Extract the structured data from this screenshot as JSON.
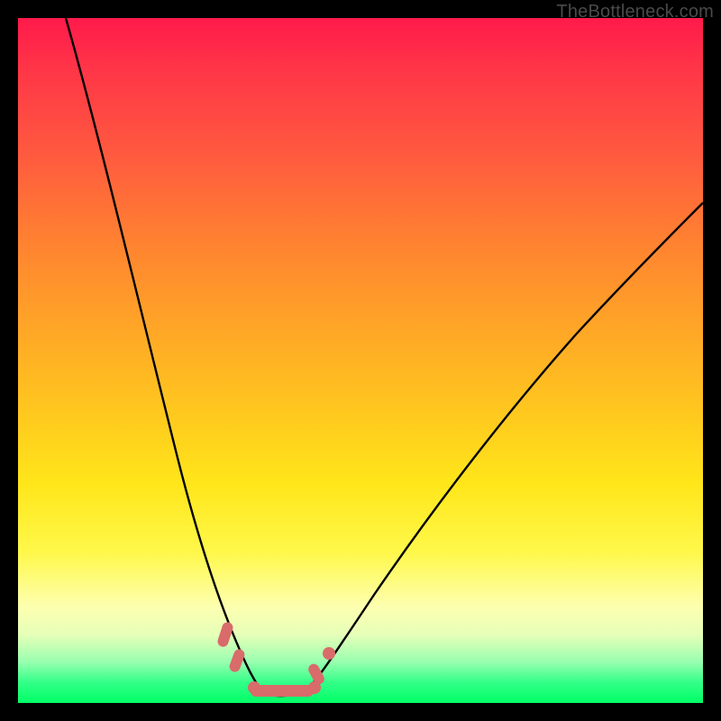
{
  "watermark": "TheBottleneck.com",
  "colors": {
    "background": "#000000",
    "curve": "#000000",
    "marker": "#d96b6b",
    "gradient_top": "#ff1a4b",
    "gradient_bottom": "#00ff66"
  },
  "chart_data": {
    "type": "line",
    "title": "",
    "xlabel": "",
    "ylabel": "",
    "xlim": [
      0,
      100
    ],
    "ylim": [
      0,
      100
    ],
    "annotations": [
      "TheBottleneck.com"
    ],
    "series": [
      {
        "name": "left-branch",
        "x": [
          7,
          10,
          13,
          16,
          19,
          22,
          24,
          26,
          28,
          30,
          32,
          33.5,
          35
        ],
        "y": [
          100,
          88,
          76,
          64,
          52,
          40,
          31,
          23,
          17,
          11,
          6,
          3.5,
          2
        ]
      },
      {
        "name": "valley-floor",
        "x": [
          35,
          36,
          37,
          38,
          39,
          40,
          41,
          42
        ],
        "y": [
          2,
          1.4,
          1.1,
          1.0,
          1.0,
          1.1,
          1.5,
          2.2
        ]
      },
      {
        "name": "right-branch",
        "x": [
          42,
          45,
          50,
          55,
          60,
          65,
          70,
          75,
          80,
          85,
          90,
          95,
          100
        ],
        "y": [
          2.2,
          6,
          13,
          21,
          29,
          36,
          43,
          50,
          56,
          62,
          67,
          72,
          76
        ]
      }
    ],
    "markers": [
      {
        "name": "left-cluster-upper",
        "x": 30.5,
        "y": 10,
        "shape": "segment"
      },
      {
        "name": "left-cluster-lower",
        "x": 32.5,
        "y": 5,
        "shape": "segment"
      },
      {
        "name": "floor-bar",
        "x": 38,
        "y": 1.5,
        "shape": "bar"
      },
      {
        "name": "right-dot",
        "x": 44,
        "y": 5,
        "shape": "dot"
      },
      {
        "name": "right-segment",
        "x": 43,
        "y": 3.5,
        "shape": "segment"
      }
    ]
  }
}
